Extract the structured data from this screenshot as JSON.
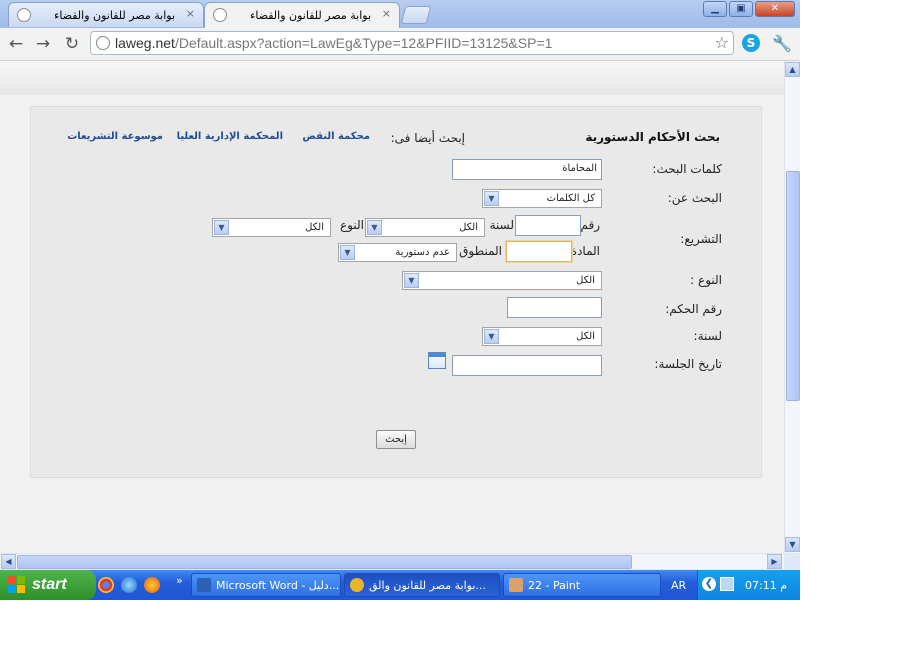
{
  "browser": {
    "tabs": [
      {
        "title": "بوابة مصر للقانون والقضاء",
        "active": false
      },
      {
        "title": "بوابة مصر للقانون والقضاء",
        "active": true
      }
    ],
    "close_glyph": "×",
    "url_host": "laweg.net",
    "url_path": "/Default.aspx?action=LawEg&Type=12&PFIID=13125&SP=1",
    "icons": [
      "back-icon",
      "forward-icon",
      "reload-icon",
      "globe-icon",
      "star-icon",
      "skype-icon",
      "wrench-icon"
    ]
  },
  "form": {
    "title": "بحث الأحكام الدستورية",
    "also_search_label": "إبحث أيضا فى:",
    "links": [
      "محكمة النقض",
      "المحكمة الإدارية العليا",
      "موسوعة التشريعات"
    ],
    "keywords_label": "كلمات البحث:",
    "keywords_value": "المحاماة",
    "search_for_label": "البحث عن:",
    "search_for_value": "كل الكلمات",
    "legislation_label": "التشريع:",
    "number_label": "رقم",
    "year_label": "لسنة",
    "year_value": "الكل",
    "type_label": "النوع",
    "type_value": "الكل",
    "article_label": "المادة",
    "verdict_label": "المنطوق",
    "verdict_value": "عدم دستورية",
    "kind_label": "النوع :",
    "kind_value": "الكل",
    "ruling_number_label": "رقم الحكم:",
    "ruling_year_label": "لسنة:",
    "ruling_year_value": "الكل",
    "session_date_label": "تاريخ الجلسة:",
    "submit_label": "إبحث"
  },
  "taskbar": {
    "start_label": "start",
    "tasks": [
      {
        "label": "Microsoft Word - دليل...",
        "active": false,
        "icon_color": "#2b5fb8"
      },
      {
        "label": "بوابة مصر للقانون والق...",
        "active": true,
        "icon_color": "#e8b428"
      },
      {
        "label": "22 - Paint",
        "active": false,
        "icon_color": "#d9a26a"
      }
    ],
    "language": "AR",
    "clock": "07:11 م",
    "chevron": "»"
  }
}
